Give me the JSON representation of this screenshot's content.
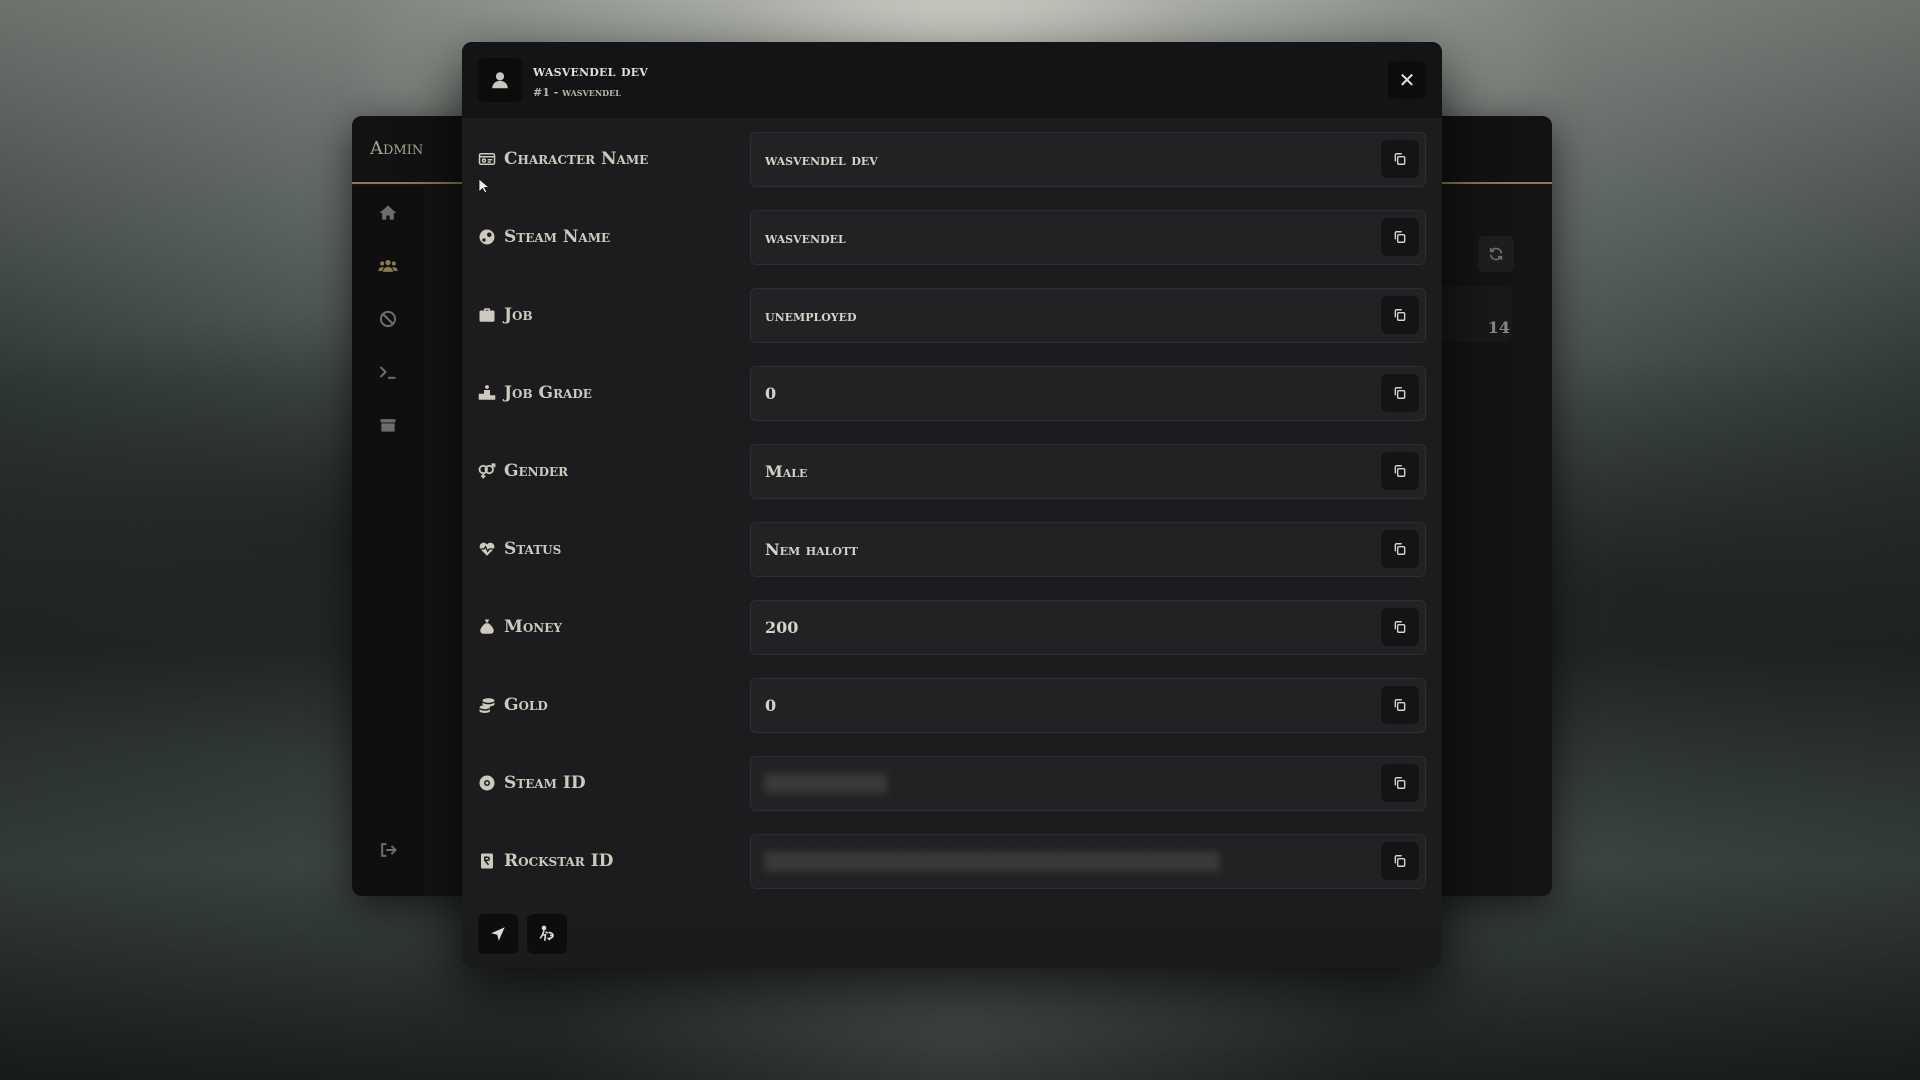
{
  "admin": {
    "title": "Admin",
    "count": "14",
    "sidebar": [
      "home-icon",
      "users-icon",
      "ban-icon",
      "terminal-icon",
      "box-icon"
    ]
  },
  "modal": {
    "title": "wasvendel dev",
    "subtitle": "#1 - wasvendel",
    "close_label": "✕"
  },
  "fields": [
    {
      "key": "character_name",
      "label": "Character Name",
      "value": "wasvendel dev",
      "icon": "id-card-icon"
    },
    {
      "key": "steam_name",
      "label": "Steam Name",
      "value": "wasvendel",
      "icon": "steam-icon"
    },
    {
      "key": "job",
      "label": "Job",
      "value": "unemployed",
      "icon": "briefcase-icon"
    },
    {
      "key": "job_grade",
      "label": "Job Grade",
      "value": "0",
      "icon": "podium-icon"
    },
    {
      "key": "gender",
      "label": "Gender",
      "value": "Male",
      "icon": "gender-icon"
    },
    {
      "key": "status",
      "label": "Status",
      "value": "Nem halott",
      "icon": "heart-pulse-icon"
    },
    {
      "key": "money",
      "label": "Money",
      "value": "200",
      "icon": "money-bag-icon"
    },
    {
      "key": "gold",
      "label": "Gold",
      "value": "0",
      "icon": "coins-icon"
    },
    {
      "key": "steam_id",
      "label": "Steam ID",
      "value": "",
      "icon": "steam-id-icon",
      "blurred": true
    },
    {
      "key": "rockstar_id",
      "label": "Rockstar ID",
      "value": "",
      "icon": "rockstar-icon",
      "blurred": true
    }
  ],
  "colors": {
    "accent": "#8c7a52",
    "modal_bg": "#1c1c1e",
    "field_bg": "#222225"
  }
}
